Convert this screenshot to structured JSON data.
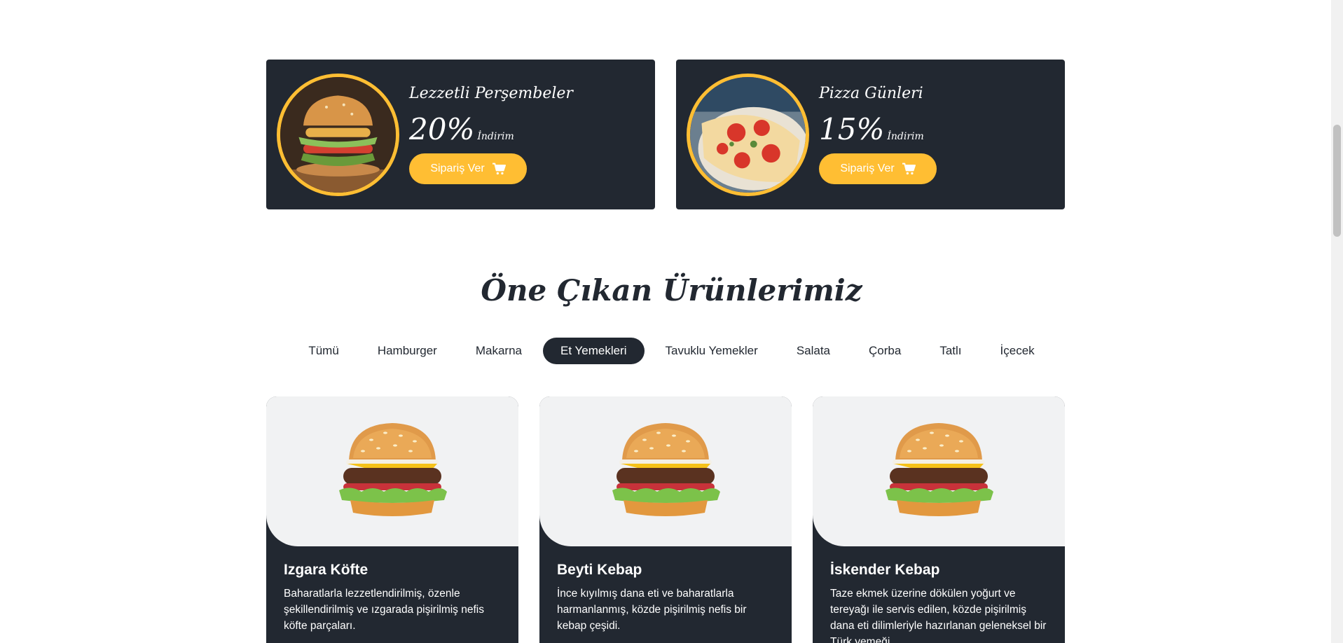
{
  "offers": [
    {
      "title": "Lezzetli Perşembeler",
      "percent": "20%",
      "discount_label": "İndirim",
      "button_label": "Sipariş Ver",
      "image": "burger-photo"
    },
    {
      "title": "Pizza Günleri",
      "percent": "15%",
      "discount_label": "İndirim",
      "button_label": "Sipariş Ver",
      "image": "pizza-photo"
    }
  ],
  "section": {
    "title": "Öne Çıkan Ürünlerimiz"
  },
  "filters": [
    {
      "label": "Tümü",
      "active": false
    },
    {
      "label": "Hamburger",
      "active": false
    },
    {
      "label": "Makarna",
      "active": false
    },
    {
      "label": "Et Yemekleri",
      "active": true
    },
    {
      "label": "Tavuklu Yemekler",
      "active": false
    },
    {
      "label": "Salata",
      "active": false
    },
    {
      "label": "Çorba",
      "active": false
    },
    {
      "label": "Tatlı",
      "active": false
    },
    {
      "label": "İçecek",
      "active": false
    }
  ],
  "products": [
    {
      "title": "Izgara Köfte",
      "description": "Baharatlarla lezzetlendirilmiş, özenle şekillendirilmiş ve ızgarada pişirilmiş nefis köfte parçaları.",
      "image": "burger-image"
    },
    {
      "title": "Beyti Kebap",
      "description": "İnce kıyılmış dana eti ve baharatlarla harmanlanmış, közde pişirilmiş nefis bir kebap çeşidi.",
      "image": "burger-image"
    },
    {
      "title": "İskender Kebap",
      "description": "Taze ekmek üzerine dökülen yoğurt ve tereyağı ile servis edilen, közde pişirilmiş dana eti dilimleriyle hazırlanan geleneksel bir Türk yemeği.",
      "image": "burger-image"
    }
  ],
  "colors": {
    "dark": "#222831",
    "accent": "#ffbe33",
    "card_image_bg": "#f1f2f3",
    "background": "#ffffff"
  }
}
